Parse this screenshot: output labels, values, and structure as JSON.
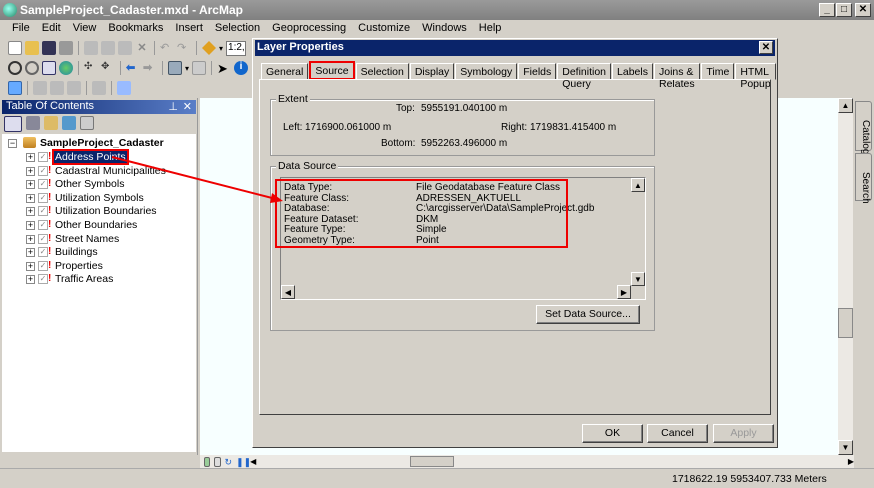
{
  "window": {
    "title": "SampleProject_Cadaster.mxd - ArcMap",
    "min": "_",
    "max": "□",
    "close": "✕"
  },
  "menu": [
    "File",
    "Edit",
    "View",
    "Bookmarks",
    "Insert",
    "Selection",
    "Geoprocessing",
    "Customize",
    "Windows",
    "Help"
  ],
  "toolbar": {
    "scale": "1:2,"
  },
  "toc": {
    "title": "Table Of Contents",
    "pin": "⊥",
    "close": "✕",
    "root": "SampleProject_Cadaster",
    "layers": [
      "Address Points",
      "Cadastral Municipalities",
      "Other Symbols",
      "Utilization Symbols",
      "Utilization Boundaries",
      "Other Boundaries",
      "Street Names",
      "Buildings",
      "Properties",
      "Traffic Areas"
    ]
  },
  "side_tabs": [
    "Catalog",
    "Search"
  ],
  "status": {
    "coords": "1718622.19  5953407.733 Meters"
  },
  "dialog": {
    "title": "Layer Properties",
    "close": "✕",
    "tabs": [
      "General",
      "Source",
      "Selection",
      "Display",
      "Symbology",
      "Fields",
      "Definition Query",
      "Labels",
      "Joins & Relates",
      "Time",
      "HTML Popup"
    ],
    "active_tab": "Source",
    "extent": {
      "label": "Extent",
      "top_label": "Top:",
      "top": "5955191.040100 m",
      "left_label": "Left:",
      "left": "1716900.061000 m",
      "right_label": "Right:",
      "right": "1719831.415400 m",
      "bottom_label": "Bottom:",
      "bottom": "5952263.496000 m"
    },
    "data_source": {
      "label": "Data Source",
      "rows": [
        {
          "k": "Data Type:",
          "v": "File Geodatabase Feature Class"
        },
        {
          "k": "Feature Class:",
          "v": "ADRESSEN_AKTUELL"
        },
        {
          "k": "Database:",
          "v": "C:\\arcgisserver\\Data\\SampleProject.gdb"
        },
        {
          "k": "Feature Dataset:",
          "v": "DKM"
        },
        {
          "k": "Feature Type:",
          "v": "Simple"
        },
        {
          "k": "Geometry Type:",
          "v": "Point"
        }
      ],
      "set_button": "Set Data Source..."
    },
    "ok": "OK",
    "cancel": "Cancel",
    "apply": "Apply"
  },
  "colors": {
    "highlight": "#ff0000",
    "selection": "#0a246a"
  }
}
